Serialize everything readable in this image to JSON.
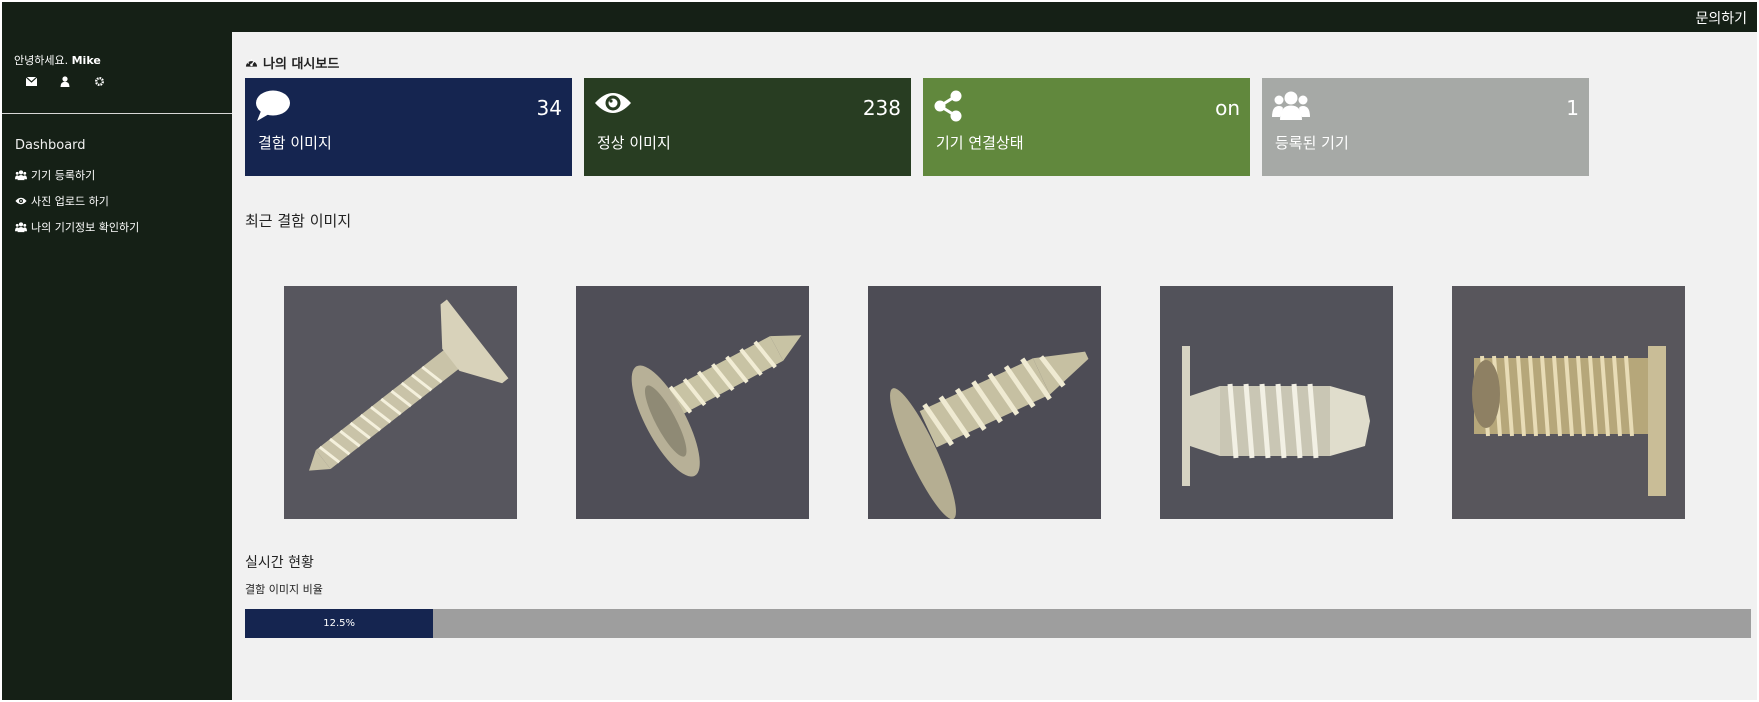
{
  "header": {
    "contact_label": "문의하기"
  },
  "sidebar": {
    "greeting_prefix": "안녕하세요.",
    "user_name": "Mike",
    "heading": "Dashboard",
    "items": [
      {
        "label": "기기 등록하기",
        "icon": "users-icon"
      },
      {
        "label": "사진 업로드 하기",
        "icon": "eye-icon"
      },
      {
        "label": "나의 기기정보 확인하기",
        "icon": "users-icon"
      }
    ]
  },
  "dashboard": {
    "title": "나의 대시보드",
    "cards": [
      {
        "label": "결함 이미지",
        "value": "34",
        "icon": "comment-icon",
        "color": "#152550"
      },
      {
        "label": "정상 이미지",
        "value": "238",
        "icon": "eye-icon",
        "color": "#283d22"
      },
      {
        "label": "기기 연결상태",
        "value": "on",
        "icon": "share-icon",
        "color": "#61883d"
      },
      {
        "label": "등록된 기기",
        "value": "1",
        "icon": "users-icon",
        "color": "#a6a9a6"
      }
    ]
  },
  "recent": {
    "title": "최근 결함 이미지",
    "image_count": 5
  },
  "realtime": {
    "title": "실시간 현황",
    "subtitle": "결함 이미지 비율",
    "progress_text": "12.5%",
    "progress_fraction": 0.125
  },
  "colors": {
    "sidebar_bg": "#152016",
    "progress_fill": "#152550",
    "progress_track": "#9e9e9e"
  }
}
